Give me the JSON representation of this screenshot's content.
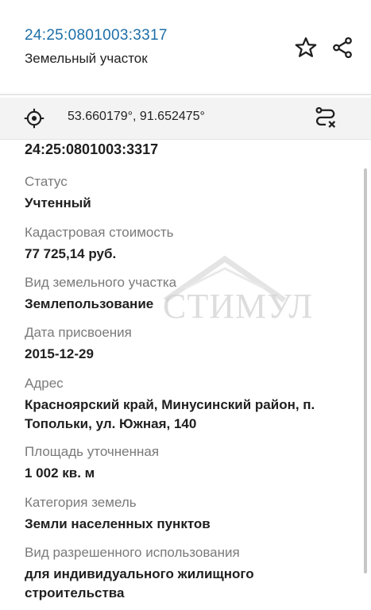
{
  "header": {
    "cadastral_link": "24:25:0801003:3317",
    "object_type": "Земельный участок",
    "star_icon": "star-outline-icon",
    "share_icon": "share-icon"
  },
  "coordinates": {
    "icon": "crosshair-target-icon",
    "text": "53.660179°, 91.652475°",
    "route_icon": "route-clear-icon"
  },
  "details": {
    "cadastral_number": "24:25:0801003:3317",
    "status_label": "Статус",
    "status_value": "Учтенный",
    "cost_label": "Кадастровая стоимость",
    "cost_value": "77 725,14 руб.",
    "land_kind_label": "Вид земельного участка",
    "land_kind_value": "Землепользование",
    "date_label": "Дата присвоения",
    "date_value": "2015-12-29",
    "address_label": "Адрес",
    "address_value": "Красноярский край, Минусинский район, п. Топольки, ул. Южная, 140",
    "area_label": "Площадь уточненная",
    "area_value": "1 002 кв. м",
    "category_label": "Категория земель",
    "category_value": "Земли населенных пунктов",
    "use_label": "Вид разрешенного использования",
    "use_value": "для индивидуального жилищного строительства"
  },
  "watermark": {
    "text": "СТИМУЛ"
  },
  "colors": {
    "link": "#1c6fa8",
    "label": "#7a7a7a",
    "value": "#1f1f1f",
    "bar_bg": "#f3f3f3"
  }
}
